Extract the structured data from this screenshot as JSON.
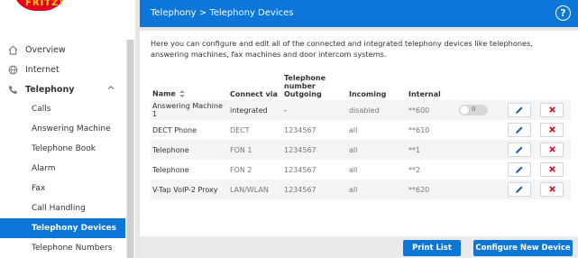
{
  "header": {
    "breadcrumb_parent": "Telephony",
    "breadcrumb_separator": ">",
    "breadcrumb_current": "Telephony Devices",
    "help_label": "?"
  },
  "logo": {
    "brand_text": "FRITZ!",
    "icon": "fritz-logo"
  },
  "sidebar": {
    "top_items": [
      {
        "label": "Overview",
        "icon": "home-icon"
      },
      {
        "label": "Internet",
        "icon": "globe-icon"
      },
      {
        "label": "Telephony",
        "icon": "phone-icon"
      }
    ],
    "sub_items": [
      {
        "label": "Calls"
      },
      {
        "label": "Answering Machine"
      },
      {
        "label": "Telephone Book"
      },
      {
        "label": "Alarm"
      },
      {
        "label": "Fax"
      },
      {
        "label": "Call Handling"
      },
      {
        "label": "Telephony Devices"
      },
      {
        "label": "Telephone Numbers"
      }
    ],
    "active_sub_index": 6
  },
  "panel": {
    "intro": "Here you can configure and edit all of the connected and integrated telephony devices like telephones, answering machines, fax machines and door intercom systems.",
    "table": {
      "headers": {
        "name": "Name",
        "connect_via": "Connect via",
        "tel_number_group": "Telephone number",
        "outgoing": "Outgoing",
        "incoming": "Incoming",
        "internal": "Internal"
      },
      "rows": [
        {
          "name": "Answering Machine 1",
          "connect_via": "integrated",
          "outgoing": "-",
          "incoming": "disabled",
          "internal": "**600",
          "toggle": "0"
        },
        {
          "name": "DECT Phone",
          "connect_via": "DECT",
          "outgoing": "1234567",
          "incoming": "all",
          "internal": "**610",
          "toggle": ""
        },
        {
          "name": "Telephone",
          "connect_via": "FON 1",
          "outgoing": "1234567",
          "incoming": "all",
          "internal": "**1",
          "toggle": ""
        },
        {
          "name": "Telephone",
          "connect_via": "FON 2",
          "outgoing": "1234567",
          "incoming": "all",
          "internal": "**2",
          "toggle": ""
        },
        {
          "name": "V-Tap VoIP-2 Proxy",
          "connect_via": "LAN/WLAN",
          "outgoing": "1234567",
          "incoming": "all",
          "internal": "**620",
          "toggle": ""
        }
      ]
    }
  },
  "footer": {
    "print_list": "Print List",
    "configure_new": "Configure New Device"
  },
  "colors": {
    "accent": "#0c77d9",
    "delete_red": "#e2001a",
    "edit_blue": "#1e5fa8"
  }
}
